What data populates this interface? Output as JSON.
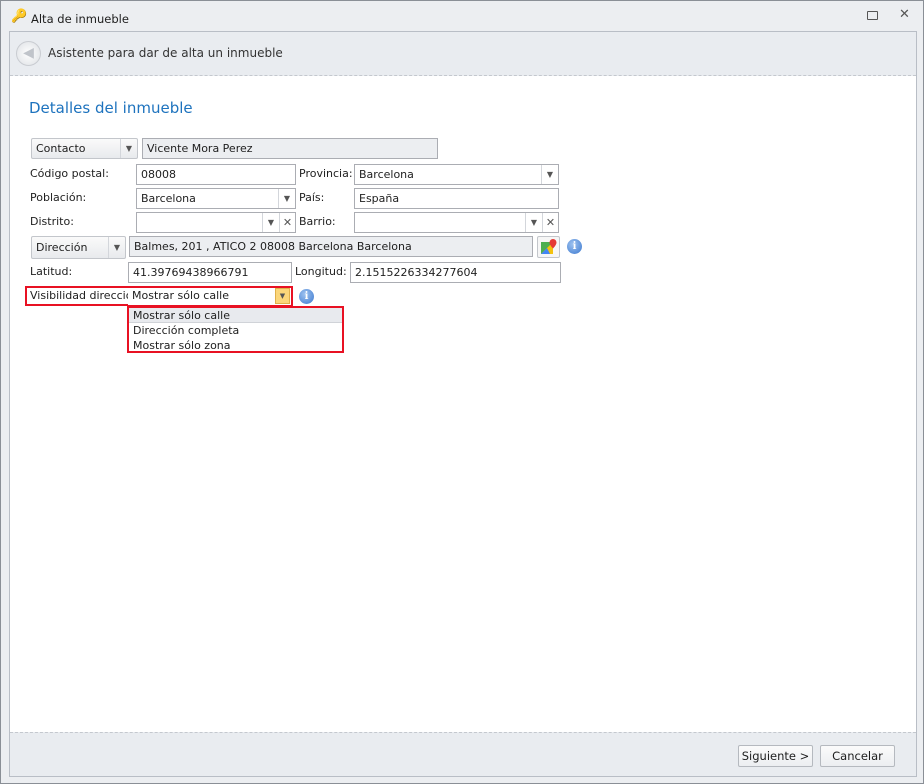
{
  "window": {
    "title": "Alta de inmueble"
  },
  "header": {
    "title": "Asistente para dar de alta un inmueble"
  },
  "section_title": "Detalles del inmueble",
  "form": {
    "contacto": {
      "selector": "Contacto",
      "value": "Vicente Mora Perez"
    },
    "codigo_postal": {
      "label": "Código postal:",
      "value": "08008"
    },
    "provincia": {
      "label": "Provincia:",
      "value": "Barcelona"
    },
    "poblacion": {
      "label": "Población:",
      "value": "Barcelona"
    },
    "pais": {
      "label": "País:",
      "value": "España"
    },
    "distrito": {
      "label": "Distrito:",
      "value": ""
    },
    "barrio": {
      "label": "Barrio:",
      "value": ""
    },
    "direccion": {
      "selector": "Dirección",
      "value": "Balmes, 201 , ATICO 2 08008 Barcelona Barcelona"
    },
    "latitud": {
      "label": "Latitud:",
      "value": "41.39769438966791"
    },
    "longitud": {
      "label": "Longitud:",
      "value": "2.1515226334277604"
    },
    "visibilidad": {
      "label": "Visibilidad dirección:",
      "value": "Mostrar sólo calle",
      "options": [
        "Mostrar sólo calle",
        "Dirección completa",
        "Mostrar sólo zona"
      ]
    }
  },
  "footer": {
    "next": "Siguiente >",
    "cancel": "Cancelar"
  },
  "colors": {
    "accent": "#1e73be",
    "highlight": "#e81123"
  }
}
